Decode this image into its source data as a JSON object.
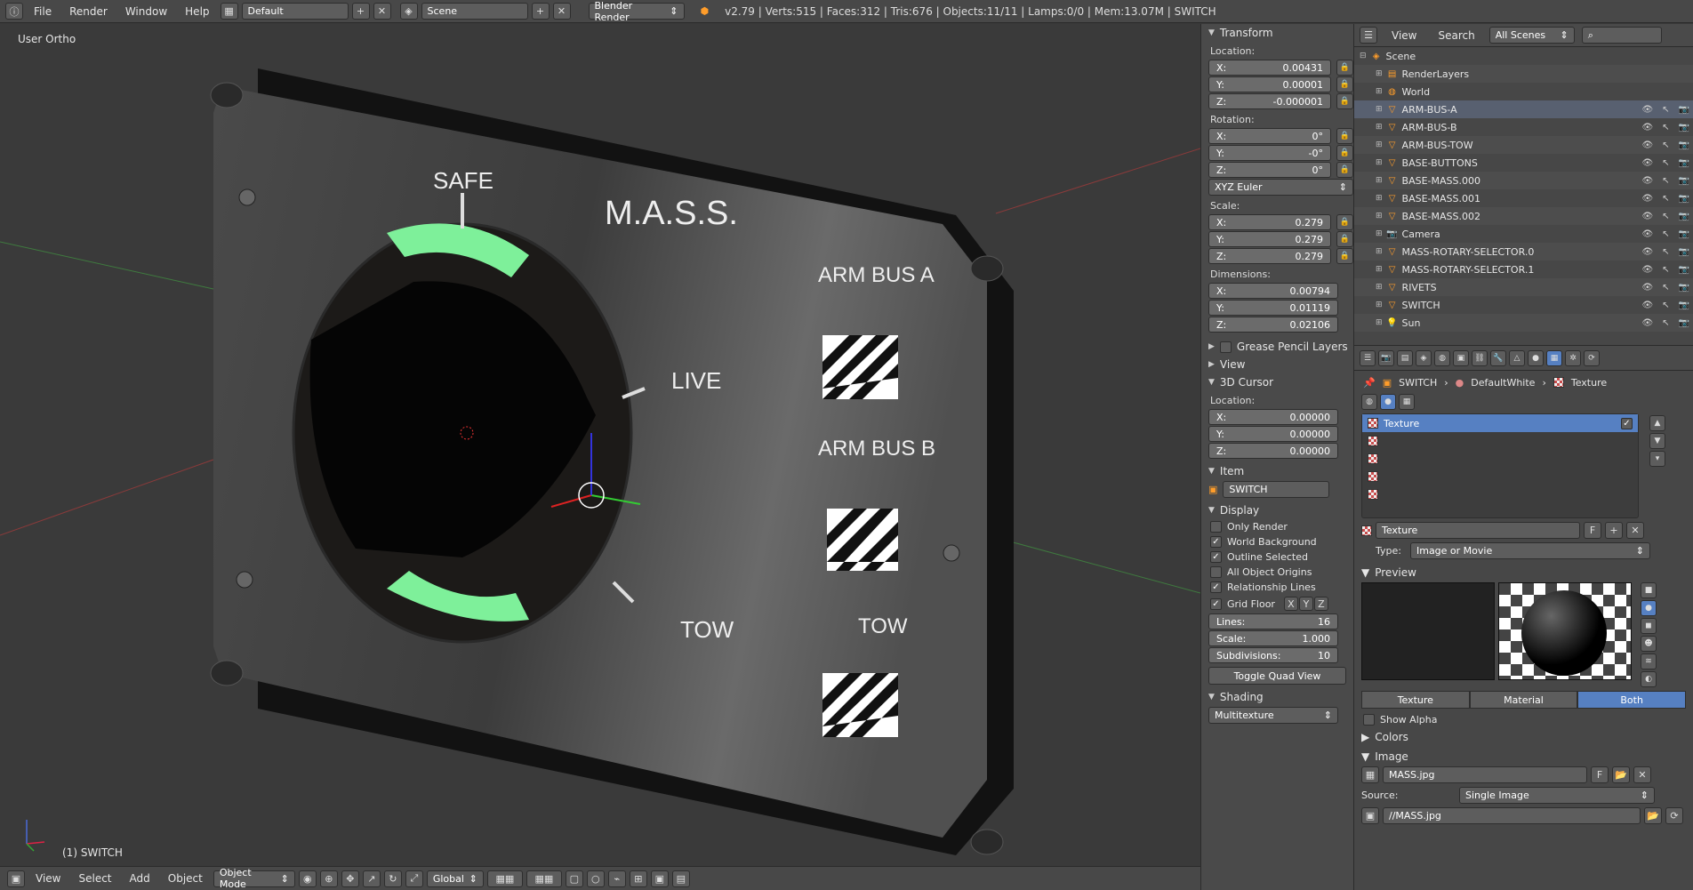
{
  "topbar": {
    "menus": [
      "File",
      "Render",
      "Window",
      "Help"
    ],
    "layout": "Default",
    "scene": "Scene",
    "engine": "Blender Render",
    "stats": "v2.79 | Verts:515 | Faces:312 | Tris:676 | Objects:11/11 | Lamps:0/0 | Mem:13.07M | SWITCH"
  },
  "viewport": {
    "view_label": "User Ortho",
    "object_label": "(1) SWITCH",
    "panel_labels": {
      "safe": "SAFE",
      "live": "LIVE",
      "tow": "TOW",
      "title": "M.A.S.S.",
      "arm_bus_a": "ARM BUS A",
      "arm_bus_b": "ARM BUS B",
      "tow_right": "TOW"
    }
  },
  "viewheader": {
    "menus": [
      "View",
      "Select",
      "Add",
      "Object"
    ],
    "mode": "Object Mode",
    "orientation": "Global"
  },
  "npanel": {
    "transform": "Transform",
    "location_label": "Location:",
    "location": {
      "x": "0.00431",
      "y": "0.00001",
      "z": "-0.000001"
    },
    "rotation_label": "Rotation:",
    "rotation": {
      "x": "0°",
      "y": "-0°",
      "z": "0°"
    },
    "rotation_mode": "XYZ Euler",
    "scale_label": "Scale:",
    "scale": {
      "x": "0.279",
      "y": "0.279",
      "z": "0.279"
    },
    "dimensions_label": "Dimensions:",
    "dimensions": {
      "x": "0.00794",
      "y": "0.01119",
      "z": "0.02106"
    },
    "grease_pencil": "Grease Pencil Layers",
    "view": "View",
    "cursor": "3D Cursor",
    "cursor_location_label": "Location:",
    "cursor_location": {
      "x": "0.00000",
      "y": "0.00000",
      "z": "0.00000"
    },
    "item": "Item",
    "item_name": "SWITCH",
    "display": "Display",
    "checks": [
      {
        "label": "Only Render",
        "checked": false
      },
      {
        "label": "World Background",
        "checked": true
      },
      {
        "label": "Outline Selected",
        "checked": true
      },
      {
        "label": "All Object Origins",
        "checked": false
      },
      {
        "label": "Relationship Lines",
        "checked": true
      }
    ],
    "grid_floor": "Grid Floor",
    "grid_axes": [
      "X",
      "Y",
      "Z"
    ],
    "lines_label": "Lines:",
    "lines": "16",
    "scale_grid_label": "Scale:",
    "scale_grid": "1.000",
    "subdiv_label": "Subdivisions:",
    "subdiv": "10",
    "toggle_quad": "Toggle Quad View",
    "shading": "Shading",
    "shading_mode": "Multitexture"
  },
  "outliner": {
    "menus": [
      "View",
      "Search"
    ],
    "filter": "All Scenes",
    "rows": [
      {
        "name": "Scene",
        "indent": 0,
        "icon": "scene"
      },
      {
        "name": "RenderLayers",
        "indent": 1,
        "icon": "layers"
      },
      {
        "name": "World",
        "indent": 1,
        "icon": "world"
      },
      {
        "name": "ARM-BUS-A",
        "indent": 1,
        "icon": "mesh"
      },
      {
        "name": "ARM-BUS-B",
        "indent": 1,
        "icon": "mesh"
      },
      {
        "name": "ARM-BUS-TOW",
        "indent": 1,
        "icon": "mesh"
      },
      {
        "name": "BASE-BUTTONS",
        "indent": 1,
        "icon": "mesh"
      },
      {
        "name": "BASE-MASS.000",
        "indent": 1,
        "icon": "mesh"
      },
      {
        "name": "BASE-MASS.001",
        "indent": 1,
        "icon": "mesh"
      },
      {
        "name": "BASE-MASS.002",
        "indent": 1,
        "icon": "mesh"
      },
      {
        "name": "Camera",
        "indent": 1,
        "icon": "camera"
      },
      {
        "name": "MASS-ROTARY-SELECTOR.0",
        "indent": 1,
        "icon": "mesh"
      },
      {
        "name": "MASS-ROTARY-SELECTOR.1",
        "indent": 1,
        "icon": "mesh"
      },
      {
        "name": "RIVETS",
        "indent": 1,
        "icon": "mesh"
      },
      {
        "name": "SWITCH",
        "indent": 1,
        "icon": "mesh"
      },
      {
        "name": "Sun",
        "indent": 1,
        "icon": "lamp"
      }
    ]
  },
  "props": {
    "crumbs": [
      "SWITCH",
      "DefaultWhite",
      "Texture"
    ],
    "tex_list": [
      "Texture"
    ],
    "tex_name": "Texture",
    "type_label": "Type:",
    "type_value": "Image or Movie",
    "preview": "Preview",
    "seg": [
      "Texture",
      "Material",
      "Both"
    ],
    "show_alpha": "Show Alpha",
    "colors": "Colors",
    "image": "Image",
    "image_name": "MASS.jpg",
    "source_label": "Source:",
    "source_value": "Single Image",
    "path": "//MASS.jpg"
  }
}
